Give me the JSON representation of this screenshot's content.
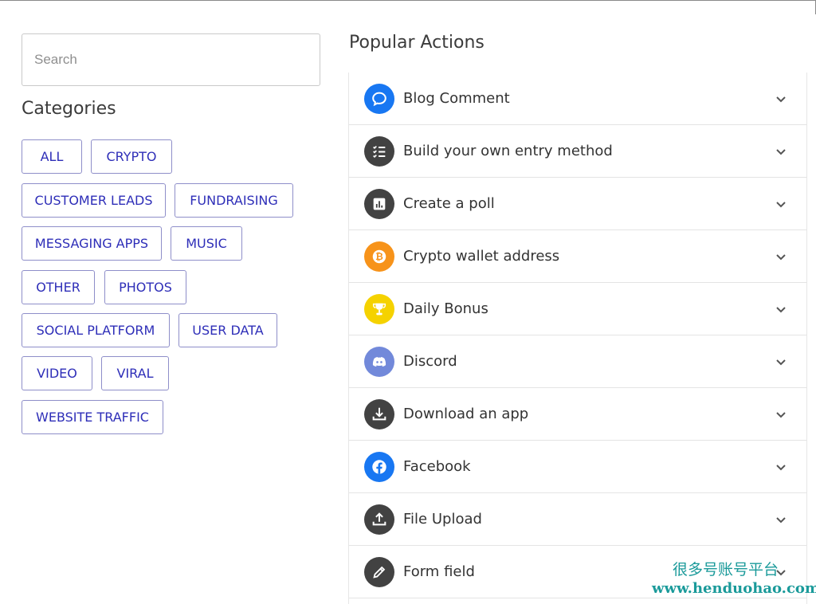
{
  "search": {
    "placeholder": "Search",
    "value": ""
  },
  "categories": {
    "title": "Categories",
    "chips": [
      {
        "label": "ALL"
      },
      {
        "label": "CRYPTO"
      },
      {
        "label": "CUSTOMER LEADS"
      },
      {
        "label": "FUNDRAISING"
      },
      {
        "label": "MESSAGING APPS"
      },
      {
        "label": "MUSIC"
      },
      {
        "label": "OTHER"
      },
      {
        "label": "PHOTOS"
      },
      {
        "label": "SOCIAL PLATFORM"
      },
      {
        "label": "USER DATA"
      },
      {
        "label": "VIDEO"
      },
      {
        "label": "VIRAL"
      },
      {
        "label": "WEBSITE TRAFFIC"
      }
    ]
  },
  "popular": {
    "title": "Popular Actions",
    "actions": [
      {
        "label": "Blog Comment",
        "icon": "chat-bubble-icon",
        "color": "#1877f2"
      },
      {
        "label": "Build your own entry method",
        "icon": "checklist-icon",
        "color": "#424242"
      },
      {
        "label": "Create a poll",
        "icon": "poll-chart-icon",
        "color": "#424242"
      },
      {
        "label": "Crypto wallet address",
        "icon": "bitcoin-icon",
        "color": "#f7931a"
      },
      {
        "label": "Daily Bonus",
        "icon": "trophy-icon",
        "color": "#f5d200"
      },
      {
        "label": "Discord",
        "icon": "discord-icon",
        "color": "#7289da"
      },
      {
        "label": "Download an app",
        "icon": "download-icon",
        "color": "#424242"
      },
      {
        "label": "Facebook",
        "icon": "facebook-icon",
        "color": "#1877f2"
      },
      {
        "label": "File Upload",
        "icon": "upload-icon",
        "color": "#424242"
      },
      {
        "label": "Form field",
        "icon": "pencil-icon",
        "color": "#424242"
      }
    ]
  },
  "watermark": {
    "cn": "很多号账号平台",
    "url": "www.henduohao.com"
  }
}
